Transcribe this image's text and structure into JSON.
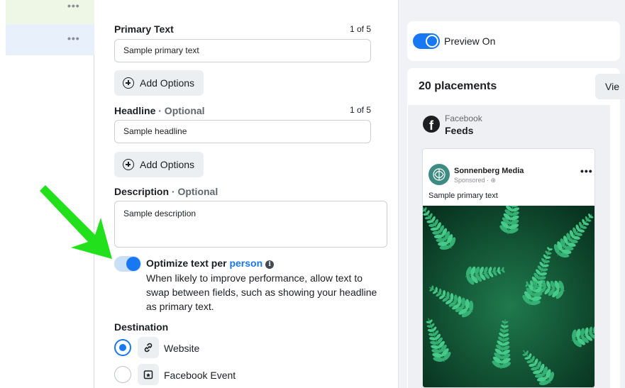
{
  "rail": {
    "dots": "•••"
  },
  "primary_text": {
    "label": "Primary Text",
    "counter": "1 of 5",
    "value": "Sample primary text",
    "add_options": "Add Options"
  },
  "headline": {
    "label": "Headline",
    "optional": " · Optional",
    "counter": "1 of 5",
    "value": "Sample headline",
    "add_options": "Add Options"
  },
  "description": {
    "label": "Description",
    "optional": " · Optional",
    "value": "Sample description"
  },
  "optimize": {
    "title_main": "Optimize text per ",
    "title_link": "person",
    "info": "i",
    "description": "When likely to improve performance, allow text to swap between fields, such as showing your headline as primary text.",
    "enabled": true
  },
  "destination": {
    "label": "Destination",
    "options": [
      {
        "label": "Website",
        "icon": "link-icon",
        "selected": true
      },
      {
        "label": "Facebook Event",
        "icon": "event-icon",
        "selected": false
      }
    ]
  },
  "preview": {
    "toggle_label": "Preview On",
    "placements_title": "20 placements",
    "view_button": "Vie",
    "platform": "Facebook",
    "position": "Feeds",
    "post": {
      "page_name": "Sonnenberg Media",
      "sponsored": "Sponsored · ",
      "dots": "•••",
      "primary_text": "Sample primary text"
    }
  },
  "colors": {
    "accent": "#1877f2",
    "arrow": "#22e01c",
    "leaf": "#2fa36a"
  }
}
